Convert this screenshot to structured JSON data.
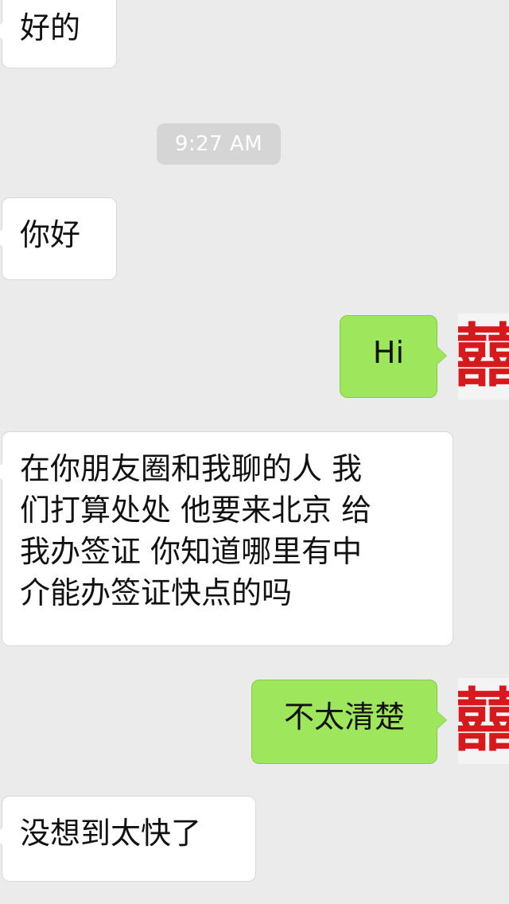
{
  "timestamp": "9:27 AM",
  "messages": [
    {
      "side": "left",
      "text": "好的"
    },
    {
      "side": "left",
      "text": "你好"
    },
    {
      "side": "right",
      "text": "Hi"
    },
    {
      "side": "left",
      "text": "在你朋友圈和我聊的人 我\n们打算处处 他要来北京 给\n我办签证 你知道哪里有中\n介能办签证快点的吗"
    },
    {
      "side": "right",
      "text": "不太清楚"
    },
    {
      "side": "left",
      "text": "没想到太快了"
    }
  ],
  "avatar": {
    "icon": "double-happiness-icon",
    "glyph": "囍",
    "color": "#d7191e"
  },
  "colors": {
    "background": "#ebebeb",
    "left_bubble": "#ffffff",
    "right_bubble": "#9ee65b",
    "timestamp_bg": "#d5d5d5"
  }
}
